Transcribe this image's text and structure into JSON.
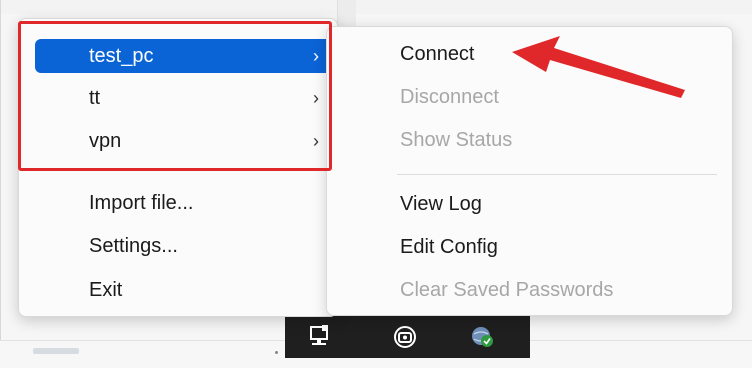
{
  "profile_menu": {
    "items": [
      {
        "label": "test_pc",
        "submenu_indicator": "›",
        "highlighted": true
      },
      {
        "label": "tt",
        "submenu_indicator": "›",
        "highlighted": false
      },
      {
        "label": "vpn",
        "submenu_indicator": "›",
        "highlighted": false
      }
    ],
    "actions": [
      {
        "label": "Import file..."
      },
      {
        "label": "Settings..."
      },
      {
        "label": "Exit"
      }
    ]
  },
  "submenu": {
    "items": [
      {
        "label": "Connect",
        "enabled": true
      },
      {
        "label": "Disconnect",
        "enabled": false
      },
      {
        "label": "Show Status",
        "enabled": false
      },
      {
        "label": "View Log",
        "enabled": true
      },
      {
        "label": "Edit Config",
        "enabled": true
      },
      {
        "label": "Clear Saved Passwords",
        "enabled": false
      }
    ]
  },
  "taskbar": {
    "tray_icons": [
      "network-pc-icon",
      "openvpn-gui-icon",
      "globe-shield-icon"
    ]
  },
  "annotation": {
    "box_color": "#e0272a",
    "arrow_color": "#e0272a"
  },
  "colors": {
    "highlight": "#0b64d6",
    "disabled_text": "#a7a7a7"
  }
}
